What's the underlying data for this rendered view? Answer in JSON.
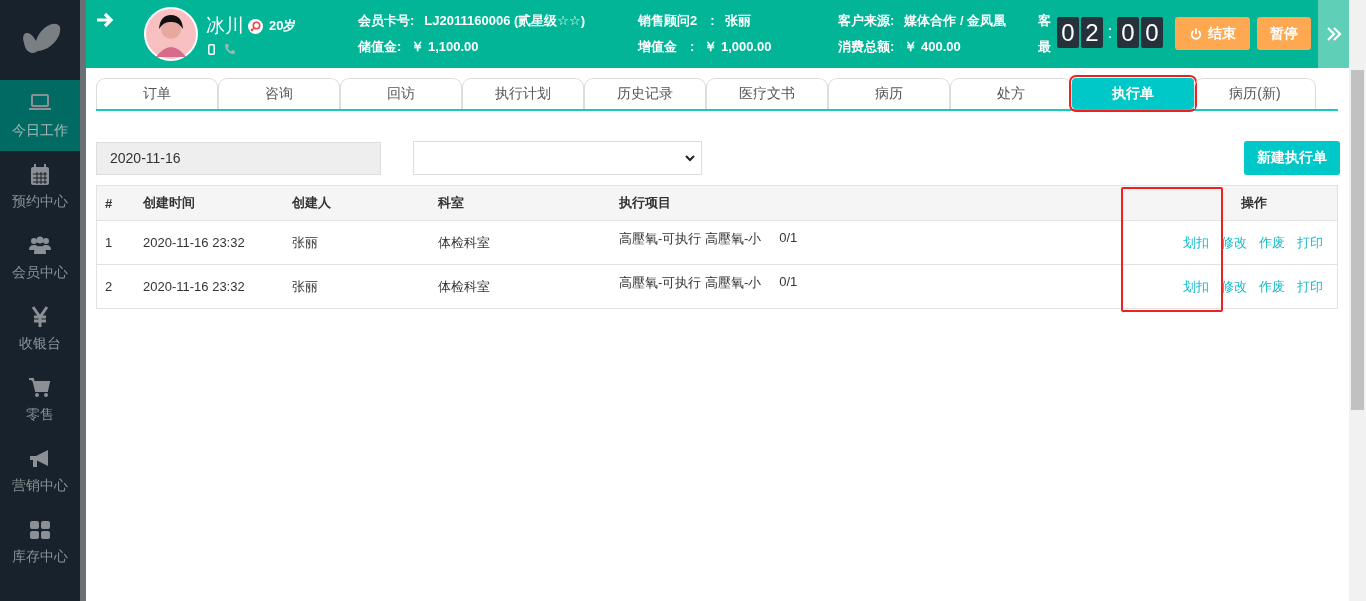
{
  "sidebar": {
    "items": [
      {
        "kind": "laptop",
        "label": "今日工作",
        "selected": true
      },
      {
        "kind": "calendar",
        "label": "预约中心",
        "selected": false
      },
      {
        "kind": "users",
        "label": "会员中心",
        "selected": false
      },
      {
        "kind": "yen",
        "label": "收银台",
        "selected": false
      },
      {
        "kind": "cart",
        "label": "零售",
        "selected": false
      },
      {
        "kind": "megaphone",
        "label": "营销中心",
        "selected": false
      },
      {
        "kind": "grid",
        "label": "库存中心",
        "selected": false
      }
    ]
  },
  "header": {
    "name": "冰川",
    "age": "20岁",
    "fields": [
      [
        {
          "label": "会员卡号:",
          "value": "LJ2011160006 (贰星级☆☆)"
        },
        {
          "label": "储值金:",
          "value": "￥ 1,100.00"
        }
      ],
      [
        {
          "label": "销售顾问2　:",
          "value": "张丽"
        },
        {
          "label": "增值金　:",
          "value": "￥ 1,000.00"
        }
      ],
      [
        {
          "label": "客户来源:",
          "value": "媒体合作 / 金凤凰"
        },
        {
          "label": "消费总额:",
          "value": "￥ 400.00"
        }
      ]
    ],
    "covered_column": [
      "客",
      "最"
    ],
    "timer": {
      "digits": [
        "0",
        "2",
        "0",
        "0"
      ],
      "separator": ":"
    },
    "buttons": [
      {
        "label": "结束",
        "kind": "power"
      },
      {
        "label": "暂停",
        "kind": "plain"
      }
    ]
  },
  "tabs": [
    {
      "label": "订单",
      "selected": false,
      "annotated": false
    },
    {
      "label": "咨询",
      "selected": false,
      "annotated": false
    },
    {
      "label": "回访",
      "selected": false,
      "annotated": false
    },
    {
      "label": "执行计划",
      "selected": false,
      "annotated": false
    },
    {
      "label": "历史记录",
      "selected": false,
      "annotated": false
    },
    {
      "label": "医疗文书",
      "selected": false,
      "annotated": false
    },
    {
      "label": "病历",
      "selected": false,
      "annotated": false
    },
    {
      "label": "处方",
      "selected": false,
      "annotated": false
    },
    {
      "label": "执行单",
      "selected": true,
      "annotated": true
    },
    {
      "label": "病历(新)",
      "selected": false,
      "annotated": false
    }
  ],
  "filters": {
    "date": "2020-11-16",
    "new_button": "新建执行单"
  },
  "table": {
    "columns": [
      "#",
      "创建时间",
      "创建人",
      "科室",
      "执行项目",
      "操作"
    ],
    "rows": [
      {
        "cells": [
          "1",
          "2020-11-16 23:32",
          "张丽",
          "体检科室",
          "高壓氧-可执行 高壓氧-小",
          "0/1"
        ],
        "actions": [
          {
            "label": "划扣",
            "annotated": true
          },
          {
            "label": "修改",
            "annotated": false
          },
          {
            "label": "作废",
            "annotated": false
          },
          {
            "label": "打印",
            "annotated": false
          }
        ]
      },
      {
        "cells": [
          "2",
          "2020-11-16 23:32",
          "张丽",
          "体检科室",
          "高壓氧-可执行 高壓氧-小",
          "0/1"
        ],
        "actions": [
          {
            "label": "划扣",
            "annotated": true
          },
          {
            "label": "修改",
            "annotated": false
          },
          {
            "label": "作废",
            "annotated": false
          },
          {
            "label": "打印",
            "annotated": false
          }
        ]
      }
    ]
  }
}
